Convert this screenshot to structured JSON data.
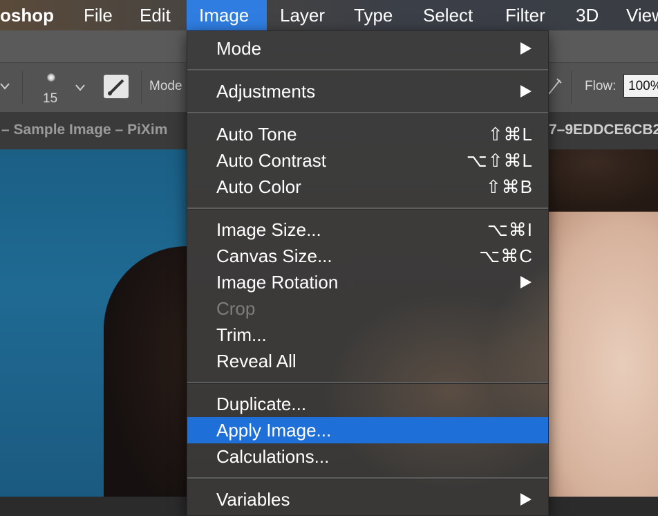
{
  "menubar": {
    "app_name": "oshop",
    "items": [
      "File",
      "Edit",
      "Image",
      "Layer",
      "Type",
      "Select",
      "Filter",
      "3D",
      "View"
    ]
  },
  "options_bar": {
    "brush_size": "15",
    "mode_label": "Mode",
    "flow_label": "Flow:",
    "flow_value": "100%"
  },
  "document": {
    "tab_left": "– Sample Image – PiXim",
    "tab_right": "7–9EDDCE6CB2"
  },
  "image_menu": {
    "mode": "Mode",
    "adjustments": "Adjustments",
    "auto_tone": "Auto Tone",
    "auto_tone_sc": "⇧⌘L",
    "auto_contrast": "Auto Contrast",
    "auto_contrast_sc": "⌥⇧⌘L",
    "auto_color": "Auto Color",
    "auto_color_sc": "⇧⌘B",
    "image_size": "Image Size...",
    "image_size_sc": "⌥⌘I",
    "canvas_size": "Canvas Size...",
    "canvas_size_sc": "⌥⌘C",
    "image_rotation": "Image Rotation",
    "crop": "Crop",
    "trim": "Trim...",
    "reveal_all": "Reveal All",
    "duplicate": "Duplicate...",
    "apply_image": "Apply Image...",
    "calculations": "Calculations...",
    "variables": "Variables"
  },
  "colors": {
    "menu_highlight": "#1f6fd9",
    "menubar_active": "#2f7de1"
  }
}
